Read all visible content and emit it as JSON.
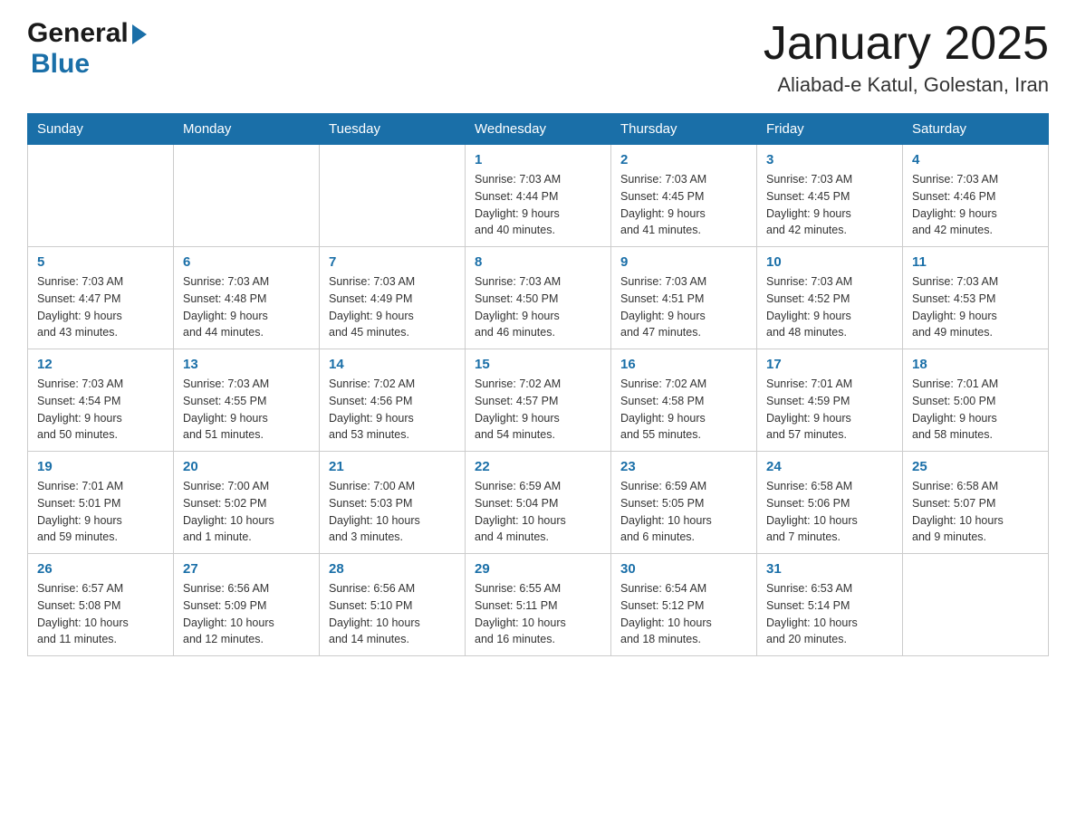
{
  "header": {
    "logo_general": "General",
    "logo_blue": "Blue",
    "month_title": "January 2025",
    "location": "Aliabad-e Katul, Golestan, Iran"
  },
  "days_of_week": [
    "Sunday",
    "Monday",
    "Tuesday",
    "Wednesday",
    "Thursday",
    "Friday",
    "Saturday"
  ],
  "weeks": [
    [
      {
        "day": "",
        "info": ""
      },
      {
        "day": "",
        "info": ""
      },
      {
        "day": "",
        "info": ""
      },
      {
        "day": "1",
        "info": "Sunrise: 7:03 AM\nSunset: 4:44 PM\nDaylight: 9 hours\nand 40 minutes."
      },
      {
        "day": "2",
        "info": "Sunrise: 7:03 AM\nSunset: 4:45 PM\nDaylight: 9 hours\nand 41 minutes."
      },
      {
        "day": "3",
        "info": "Sunrise: 7:03 AM\nSunset: 4:45 PM\nDaylight: 9 hours\nand 42 minutes."
      },
      {
        "day": "4",
        "info": "Sunrise: 7:03 AM\nSunset: 4:46 PM\nDaylight: 9 hours\nand 42 minutes."
      }
    ],
    [
      {
        "day": "5",
        "info": "Sunrise: 7:03 AM\nSunset: 4:47 PM\nDaylight: 9 hours\nand 43 minutes."
      },
      {
        "day": "6",
        "info": "Sunrise: 7:03 AM\nSunset: 4:48 PM\nDaylight: 9 hours\nand 44 minutes."
      },
      {
        "day": "7",
        "info": "Sunrise: 7:03 AM\nSunset: 4:49 PM\nDaylight: 9 hours\nand 45 minutes."
      },
      {
        "day": "8",
        "info": "Sunrise: 7:03 AM\nSunset: 4:50 PM\nDaylight: 9 hours\nand 46 minutes."
      },
      {
        "day": "9",
        "info": "Sunrise: 7:03 AM\nSunset: 4:51 PM\nDaylight: 9 hours\nand 47 minutes."
      },
      {
        "day": "10",
        "info": "Sunrise: 7:03 AM\nSunset: 4:52 PM\nDaylight: 9 hours\nand 48 minutes."
      },
      {
        "day": "11",
        "info": "Sunrise: 7:03 AM\nSunset: 4:53 PM\nDaylight: 9 hours\nand 49 minutes."
      }
    ],
    [
      {
        "day": "12",
        "info": "Sunrise: 7:03 AM\nSunset: 4:54 PM\nDaylight: 9 hours\nand 50 minutes."
      },
      {
        "day": "13",
        "info": "Sunrise: 7:03 AM\nSunset: 4:55 PM\nDaylight: 9 hours\nand 51 minutes."
      },
      {
        "day": "14",
        "info": "Sunrise: 7:02 AM\nSunset: 4:56 PM\nDaylight: 9 hours\nand 53 minutes."
      },
      {
        "day": "15",
        "info": "Sunrise: 7:02 AM\nSunset: 4:57 PM\nDaylight: 9 hours\nand 54 minutes."
      },
      {
        "day": "16",
        "info": "Sunrise: 7:02 AM\nSunset: 4:58 PM\nDaylight: 9 hours\nand 55 minutes."
      },
      {
        "day": "17",
        "info": "Sunrise: 7:01 AM\nSunset: 4:59 PM\nDaylight: 9 hours\nand 57 minutes."
      },
      {
        "day": "18",
        "info": "Sunrise: 7:01 AM\nSunset: 5:00 PM\nDaylight: 9 hours\nand 58 minutes."
      }
    ],
    [
      {
        "day": "19",
        "info": "Sunrise: 7:01 AM\nSunset: 5:01 PM\nDaylight: 9 hours\nand 59 minutes."
      },
      {
        "day": "20",
        "info": "Sunrise: 7:00 AM\nSunset: 5:02 PM\nDaylight: 10 hours\nand 1 minute."
      },
      {
        "day": "21",
        "info": "Sunrise: 7:00 AM\nSunset: 5:03 PM\nDaylight: 10 hours\nand 3 minutes."
      },
      {
        "day": "22",
        "info": "Sunrise: 6:59 AM\nSunset: 5:04 PM\nDaylight: 10 hours\nand 4 minutes."
      },
      {
        "day": "23",
        "info": "Sunrise: 6:59 AM\nSunset: 5:05 PM\nDaylight: 10 hours\nand 6 minutes."
      },
      {
        "day": "24",
        "info": "Sunrise: 6:58 AM\nSunset: 5:06 PM\nDaylight: 10 hours\nand 7 minutes."
      },
      {
        "day": "25",
        "info": "Sunrise: 6:58 AM\nSunset: 5:07 PM\nDaylight: 10 hours\nand 9 minutes."
      }
    ],
    [
      {
        "day": "26",
        "info": "Sunrise: 6:57 AM\nSunset: 5:08 PM\nDaylight: 10 hours\nand 11 minutes."
      },
      {
        "day": "27",
        "info": "Sunrise: 6:56 AM\nSunset: 5:09 PM\nDaylight: 10 hours\nand 12 minutes."
      },
      {
        "day": "28",
        "info": "Sunrise: 6:56 AM\nSunset: 5:10 PM\nDaylight: 10 hours\nand 14 minutes."
      },
      {
        "day": "29",
        "info": "Sunrise: 6:55 AM\nSunset: 5:11 PM\nDaylight: 10 hours\nand 16 minutes."
      },
      {
        "day": "30",
        "info": "Sunrise: 6:54 AM\nSunset: 5:12 PM\nDaylight: 10 hours\nand 18 minutes."
      },
      {
        "day": "31",
        "info": "Sunrise: 6:53 AM\nSunset: 5:14 PM\nDaylight: 10 hours\nand 20 minutes."
      },
      {
        "day": "",
        "info": ""
      }
    ]
  ]
}
